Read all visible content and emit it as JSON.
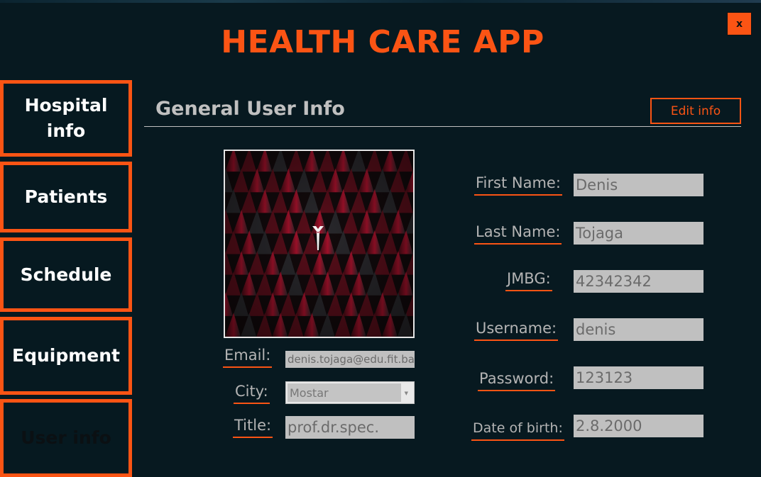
{
  "window": {
    "close_label": "x"
  },
  "app_title": "HEALTH CARE APP",
  "sidebar": {
    "items": [
      {
        "label": "Hospital info"
      },
      {
        "label": "Patients"
      },
      {
        "label": "Schedule"
      },
      {
        "label": "Equipment"
      },
      {
        "label": "User info",
        "active": true
      }
    ]
  },
  "section": {
    "title": "General User Info",
    "edit_label": "Edit info"
  },
  "profile_image": {
    "alt": "profile-picture"
  },
  "left_form": {
    "email_label": "Email:",
    "email_value": "denis.tojaga@edu.fit.ba",
    "city_label": "City:",
    "city_value": "Mostar",
    "title_label": "Title:",
    "title_value": "prof.dr.spec."
  },
  "right_form": {
    "first_name_label": "First Name:",
    "first_name_value": "Denis",
    "last_name_label": "Last Name:",
    "last_name_value": "Tojaga",
    "jmbg_label": "JMBG:",
    "jmbg_value": "42342342",
    "username_label": "Username:",
    "username_value": "denis",
    "password_label": "Password:",
    "password_value": "123123",
    "dob_label": "Date of birth:",
    "dob_value": "2.8.2000"
  },
  "colors": {
    "accent": "#fb5414",
    "background": "#071920",
    "field": "#c0c0c0"
  }
}
